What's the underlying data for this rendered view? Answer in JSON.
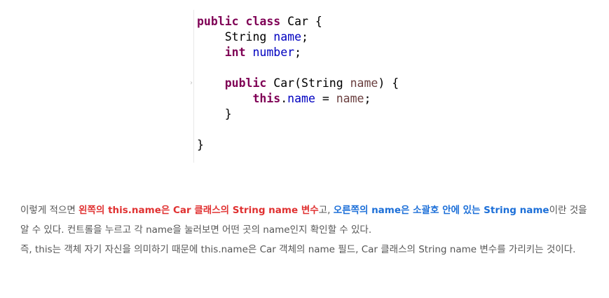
{
  "code": {
    "l1": {
      "a": "public",
      "b": " ",
      "c": "class",
      "d": " Car {"
    },
    "l2": {
      "a": "    String ",
      "b": "name",
      "c": ";"
    },
    "l3": {
      "a": "    ",
      "b": "int",
      "c": " ",
      "d": "number",
      "e": ";"
    },
    "l4": {
      "a": "    ",
      "b": "public",
      "c": " Car(String ",
      "d": "name",
      "e": ") {"
    },
    "l5": {
      "a": "        ",
      "b": "this",
      "c": ".",
      "d": "name",
      "e": " = ",
      "f": "name",
      "g": ";"
    },
    "l6": {
      "a": "    }"
    },
    "l7": {
      "a": "}"
    },
    "gutter_marker": "›"
  },
  "paragraph1": {
    "t1": "이렇게 적으면 ",
    "red": "왼쪽의 this.name은 Car 클래스의 String name 변수",
    "t2": "고, ",
    "blue": "오른쪽의 name은 소괄호 안에 있는 String name",
    "t3": "이란 것을 알 수 있다. 컨트롤을 누르고 각 name을 눌러보면 어떤 곳의 name인지 확인할 수 있다."
  },
  "paragraph2": {
    "text": "즉, this는 객체 자기 자신을 의미하기 때문에 this.name은 Car 객체의 name 필드, Car 클래스의 String name 변수를 가리키는 것이다."
  }
}
